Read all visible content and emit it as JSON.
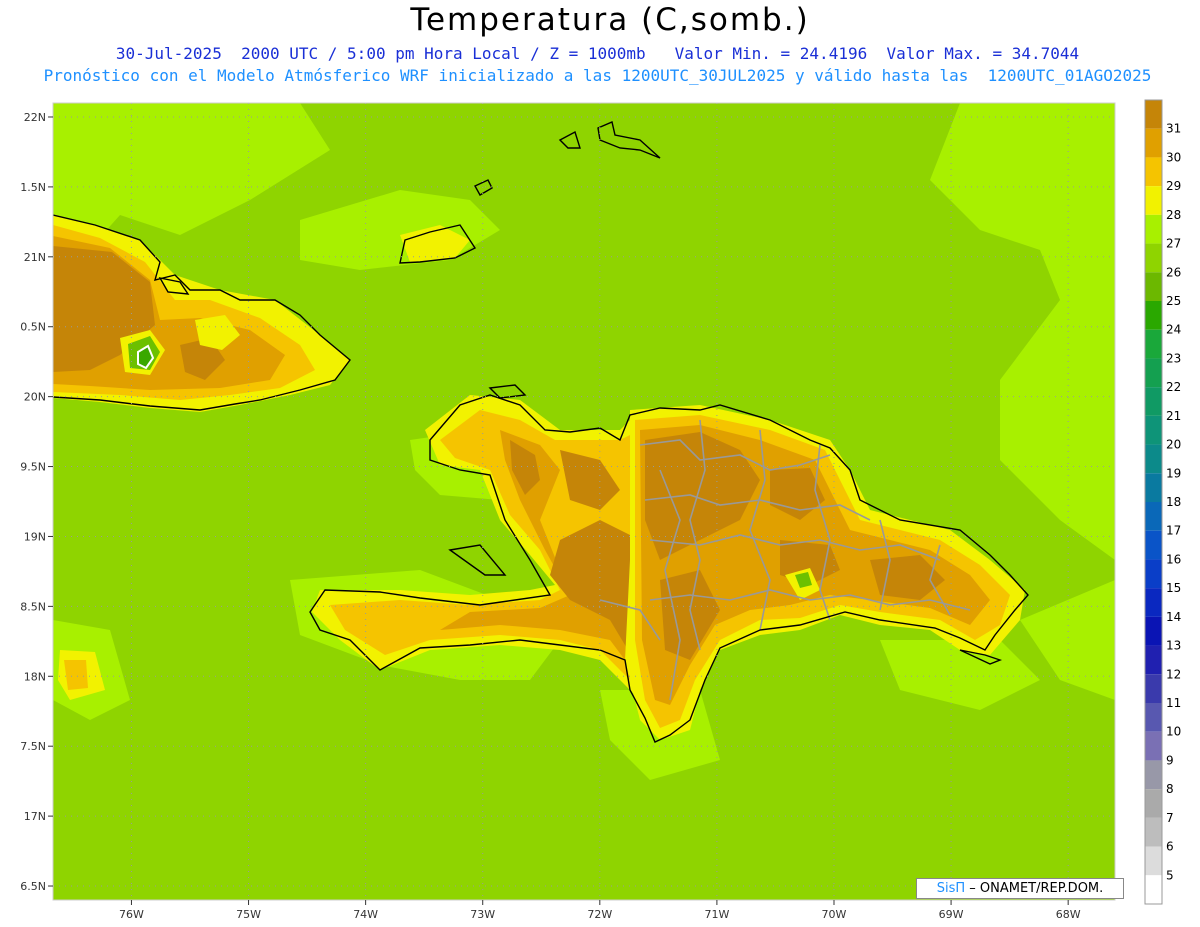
{
  "title": "Temperatura (C,somb.)",
  "subtitle_line1": "30-Jul-2025  2000 UTC / 5:00 pm Hora Local / Z = 1000mb   Valor Min. = 24.4196  Valor Max. = 34.7044",
  "subtitle_line2": "Pronóstico con el Modelo Atmósferico WRF inicializado a las 1200UTC_30JUL2025 y válido hasta las  1200UTC_01AGO2025",
  "credit_brand": "SisΠ",
  "credit_text": " – ONAMET/REP.DOM.",
  "map": {
    "lon_range": [
      -76.67,
      -67.6
    ],
    "lat_range": [
      16.4,
      22.1
    ],
    "lat_ticks": [
      {
        "value": 22.0,
        "label": "22N"
      },
      {
        "value": 21.5,
        "label": "1.5N"
      },
      {
        "value": 21.0,
        "label": "21N"
      },
      {
        "value": 20.5,
        "label": "0.5N"
      },
      {
        "value": 20.0,
        "label": "20N"
      },
      {
        "value": 19.5,
        "label": "9.5N"
      },
      {
        "value": 19.0,
        "label": "19N"
      },
      {
        "value": 18.5,
        "label": "8.5N"
      },
      {
        "value": 18.0,
        "label": "18N"
      },
      {
        "value": 17.5,
        "label": "7.5N"
      },
      {
        "value": 17.0,
        "label": "17N"
      },
      {
        "value": 16.5,
        "label": "6.5N"
      }
    ],
    "lon_ticks": [
      {
        "value": -76,
        "label": "76W"
      },
      {
        "value": -75,
        "label": "75W"
      },
      {
        "value": -74,
        "label": "74W"
      },
      {
        "value": -73,
        "label": "73W"
      },
      {
        "value": -72,
        "label": "72W"
      },
      {
        "value": -71,
        "label": "71W"
      },
      {
        "value": -70,
        "label": "70W"
      },
      {
        "value": -69,
        "label": "69W"
      },
      {
        "value": -68,
        "label": "68W"
      }
    ],
    "colors": {
      "ocean": "#8fd400",
      "warm_sea": "#a8f000",
      "t28": "#f2f200",
      "t29": "#f5c400",
      "t30": "#e0a000",
      "t31": "#c58508",
      "cool_26": "#6cc000",
      "cool_25": "#3aa800",
      "coast": "#000000",
      "province": "#999999"
    }
  },
  "colorbar": {
    "levels": [
      {
        "label": "31",
        "color": "#c58508"
      },
      {
        "label": "30",
        "color": "#e0a000"
      },
      {
        "label": "29",
        "color": "#f5c400"
      },
      {
        "label": "28",
        "color": "#f2f200"
      },
      {
        "label": "27",
        "color": "#a8f000"
      },
      {
        "label": "26",
        "color": "#8fd400"
      },
      {
        "label": "25",
        "color": "#6cb800"
      },
      {
        "label": "24",
        "color": "#2aa800"
      },
      {
        "label": "23",
        "color": "#1aa83a"
      },
      {
        "label": "22",
        "color": "#14a050"
      },
      {
        "label": "21",
        "color": "#109a64"
      },
      {
        "label": "20",
        "color": "#0e9478"
      },
      {
        "label": "19",
        "color": "#0c8a8a"
      },
      {
        "label": "18",
        "color": "#0a7aa0"
      },
      {
        "label": "17",
        "color": "#0a68b8"
      },
      {
        "label": "16",
        "color": "#0a54c8"
      },
      {
        "label": "15",
        "color": "#0a3ec8"
      },
      {
        "label": "14",
        "color": "#0a28c0"
      },
      {
        "label": "13",
        "color": "#0a14b4"
      },
      {
        "label": "12",
        "color": "#2020b0"
      },
      {
        "label": "11",
        "color": "#3a3aac"
      },
      {
        "label": "10",
        "color": "#5858b0"
      },
      {
        "label": "9",
        "color": "#7a70b4"
      },
      {
        "label": "8",
        "color": "#9898a8"
      },
      {
        "label": "7",
        "color": "#aaaaaa"
      },
      {
        "label": "6",
        "color": "#bdbdbd"
      },
      {
        "label": "5",
        "color": "#dcdcdc"
      },
      {
        "label": "",
        "color": "#ffffff"
      }
    ]
  }
}
